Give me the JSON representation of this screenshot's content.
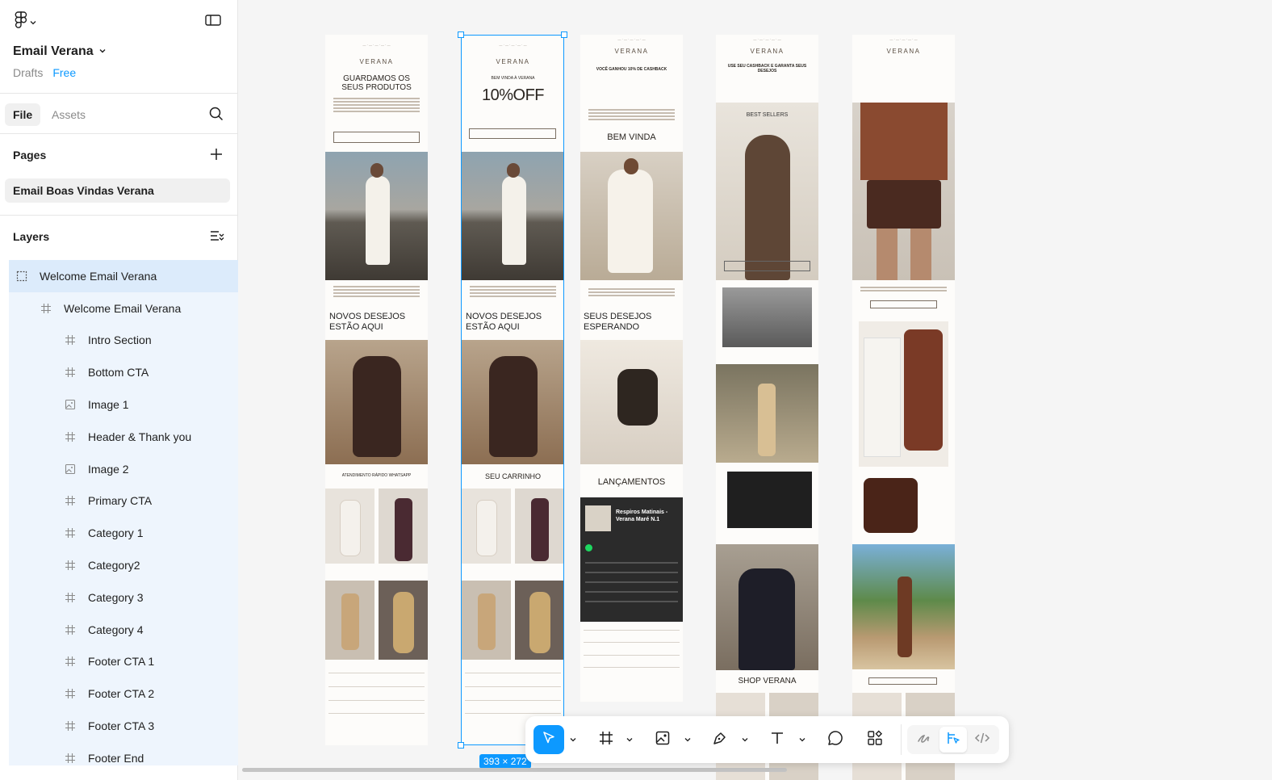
{
  "file": {
    "name": "Email Verana",
    "location": "Drafts",
    "plan": "Free"
  },
  "tabs": {
    "file": "File",
    "assets": "Assets"
  },
  "pages": {
    "title": "Pages",
    "items": [
      "Email Boas Vindas Verana"
    ]
  },
  "layers": {
    "title": "Layers",
    "items": [
      {
        "label": "Welcome Email Verana",
        "icon": "section-icon"
      },
      {
        "label": "Welcome Email Verana",
        "icon": "frame-icon"
      },
      {
        "label": "Intro Section",
        "icon": "frame-icon"
      },
      {
        "label": "Bottom CTA",
        "icon": "frame-icon"
      },
      {
        "label": "Image 1",
        "icon": "image-icon"
      },
      {
        "label": "Header & Thank you",
        "icon": "frame-icon"
      },
      {
        "label": "Image 2",
        "icon": "image-icon"
      },
      {
        "label": "Primary CTA",
        "icon": "frame-icon"
      },
      {
        "label": "Category 1",
        "icon": "frame-icon"
      },
      {
        "label": "Category2",
        "icon": "frame-icon"
      },
      {
        "label": "Category 3",
        "icon": "frame-icon"
      },
      {
        "label": "Category 4",
        "icon": "frame-icon"
      },
      {
        "label": "Footer CTA 1",
        "icon": "frame-icon"
      },
      {
        "label": "Footer CTA 2",
        "icon": "frame-icon"
      },
      {
        "label": "Footer CTA 3",
        "icon": "frame-icon"
      },
      {
        "label": "Footer End",
        "icon": "frame-icon"
      }
    ]
  },
  "canvas": {
    "selection_size": "393 × 272",
    "emails": [
      {
        "brand": "VERANA",
        "headline": "GUARDAMOS OS SEUS PRODUTOS",
        "section_title": "NOVOS DESEJOS ESTÃO AQUI",
        "bar": "ATENDIMENTO RÁPIDO WHATSAPP"
      },
      {
        "brand": "VERANA",
        "kicker": "BEM VINDA À VERANA",
        "offer": "10%OFF",
        "section_title": "NOVOS DESEJOS ESTÃO AQUI",
        "bar": "SEU CARRINHO"
      },
      {
        "brand": "VERANA",
        "headline": "VOCÊ GANHOU 10% DE CASHBACK",
        "welcome": "BEM VINDA",
        "section_title": "SEUS DESEJOS ESPERANDO",
        "bar": "LANÇAMENTOS",
        "playlist": "Respiros Matinais - Verana Maré N.1"
      },
      {
        "brand": "VERANA",
        "headline": "USE SEU CASHBACK E GARANTA SEUS DESEJOS",
        "label": "BEST SELLERS",
        "bar": "SHOP VERANA"
      },
      {
        "brand": "VERANA"
      }
    ]
  },
  "colors": {
    "accent": "#0d99ff",
    "sidebar_bg": "#ffffff",
    "canvas_bg": "#f5f5f5",
    "layer_highlight": "#eef5fd"
  }
}
